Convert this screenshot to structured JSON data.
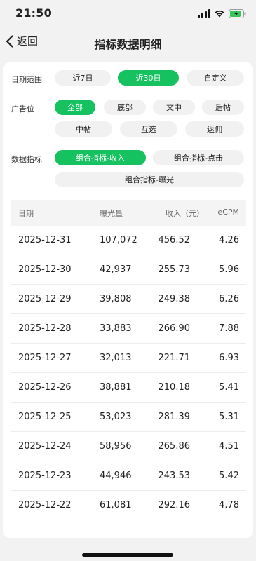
{
  "status_bar": {
    "time": "21:50"
  },
  "nav": {
    "back_label": "返回",
    "title": "指标数据明细"
  },
  "filters": {
    "date_range": {
      "label": "日期范围",
      "options": [
        "近7日",
        "近30日",
        "自定义"
      ],
      "selected": "近30日"
    },
    "ad_position": {
      "label": "广告位",
      "options": [
        "全部",
        "底部",
        "文中",
        "后帖",
        "中帖",
        "互选",
        "返佣"
      ],
      "selected": "全部"
    },
    "metric": {
      "label": "数据指标",
      "options": [
        "组合指标-收入",
        "组合指标-点击",
        "组合指标-曝光"
      ],
      "selected": "组合指标-收入"
    }
  },
  "table": {
    "headers": [
      "日期",
      "曝光量",
      "收入（元）",
      "eCPM"
    ],
    "rows": [
      [
        "2025-12-31",
        "107,072",
        "456.52",
        "4.26"
      ],
      [
        "2025-12-30",
        "42,937",
        "255.73",
        "5.96"
      ],
      [
        "2025-12-29",
        "39,808",
        "249.38",
        "6.26"
      ],
      [
        "2025-12-28",
        "33,883",
        "266.90",
        "7.88"
      ],
      [
        "2025-12-27",
        "32,013",
        "221.71",
        "6.93"
      ],
      [
        "2025-12-26",
        "38,881",
        "210.18",
        "5.41"
      ],
      [
        "2025-12-25",
        "53,023",
        "281.39",
        "5.31"
      ],
      [
        "2025-12-24",
        "58,956",
        "265.86",
        "4.51"
      ],
      [
        "2025-12-23",
        "44,946",
        "243.53",
        "5.42"
      ],
      [
        "2025-12-22",
        "61,081",
        "292.16",
        "4.78"
      ]
    ]
  },
  "colors": {
    "accent": "#16c160"
  }
}
